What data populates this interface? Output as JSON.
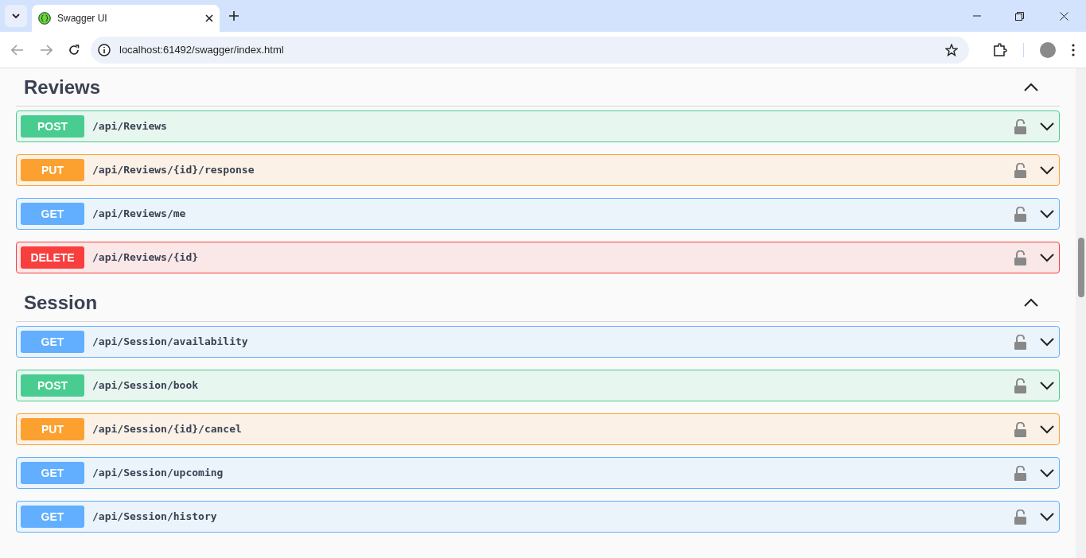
{
  "browser": {
    "tab_title": "Swagger UI",
    "url": "localhost:61492/swagger/index.html"
  },
  "sections": [
    {
      "title": "Reviews",
      "expanded": true,
      "operations": [
        {
          "kind": "post",
          "method": "POST",
          "path": "/api/Reviews"
        },
        {
          "kind": "put",
          "method": "PUT",
          "path": "/api/Reviews/{id}/response"
        },
        {
          "kind": "get",
          "method": "GET",
          "path": "/api/Reviews/me"
        },
        {
          "kind": "delete",
          "method": "DELETE",
          "path": "/api/Reviews/{id}"
        }
      ]
    },
    {
      "title": "Session",
      "expanded": true,
      "operations": [
        {
          "kind": "get",
          "method": "GET",
          "path": "/api/Session/availability"
        },
        {
          "kind": "post",
          "method": "POST",
          "path": "/api/Session/book"
        },
        {
          "kind": "put",
          "method": "PUT",
          "path": "/api/Session/{id}/cancel"
        },
        {
          "kind": "get",
          "method": "GET",
          "path": "/api/Session/upcoming"
        },
        {
          "kind": "get",
          "method": "GET",
          "path": "/api/Session/history"
        }
      ]
    }
  ]
}
